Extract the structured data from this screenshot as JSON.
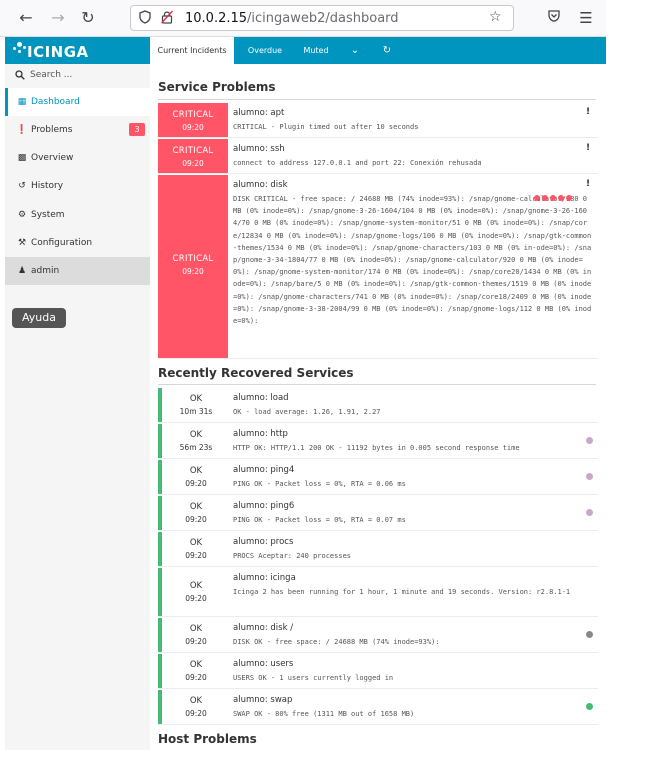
{
  "browser": {
    "url_host": "10.0.2.15",
    "url_path": "/icingaweb2/dashboard"
  },
  "sidebar": {
    "logo": "ICINGA",
    "search_placeholder": "Search ...",
    "items": [
      {
        "label": "Dashboard",
        "icon": "dashboard-icon"
      },
      {
        "label": "Problems",
        "icon": "problems-icon",
        "badge": "3"
      },
      {
        "label": "Overview",
        "icon": "binoculars-icon"
      },
      {
        "label": "History",
        "icon": "history-icon"
      },
      {
        "label": "System",
        "icon": "cogs-icon"
      },
      {
        "label": "Configuration",
        "icon": "wrench-icon"
      },
      {
        "label": "admin",
        "icon": "user-icon"
      }
    ],
    "help_button": "Ayuda"
  },
  "tabs": {
    "current": "Current Incidents",
    "overdue": "Overdue",
    "muted": "Muted"
  },
  "service_problems": {
    "title": "Service Problems",
    "rows": [
      {
        "state": "CRITICAL",
        "time": "09:20",
        "service": "alumno: apt",
        "output": "CRITICAL - Plugin timed out after 10 seconds"
      },
      {
        "state": "CRITICAL",
        "time": "09:20",
        "service": "alumno: ssh",
        "output": "connect to address 127.0.0.1 and port 22: Conexión rehusada"
      },
      {
        "state": "CRITICAL",
        "time": "09:20",
        "service": "alumno: disk",
        "output": "DISK CRITICAL - free space: / 24688 MB (74% inode=93%): /snap/gnome-calculator/180 0 MB (0% inode=0%): /snap/gnome-3-26-1604/104 0 MB (0% inode=0%): /snap/gnome-3-26-1604/70 0 MB (0% inode=0%): /snap/gnome-system-monitor/51 0 MB (0% inode=0%): /snap/core/12834 0 MB (0% inode=0%): /snap/gnome-logs/106 0 MB (0% inode=0%): /snap/gtk-common-themes/1534 0 MB (0% inode=0%): /snap/gnome-characters/103 0 MB (0% in-ode=0%): /snap/gnome-3-34-1804/77 0 MB (0% inode=0%): /snap/gnome-calculator/920 0 MB (0% inode=0%): /snap/gnome-system-monitor/174 0 MB (0% inode=0%): /snap/core20/1434 0 MB (0% inode=0%): /snap/bare/5 0 MB (0% inode=0%): /snap/gtk-common-themes/1519 0 MB (0% inode=0%): /snap/gnome-characters/741 0 MB (0% inode=0%): /snap/core18/2409 0 MB (0% inode=0%): /snap/gnome-3-38-2004/99 0 MB (0% inode=0%): /snap/gnome-logs/112 0 MB (0% inode=0%):"
      }
    ]
  },
  "recovered": {
    "title": "Recently Recovered Services",
    "rows": [
      {
        "state": "OK",
        "time": "10m 31s",
        "service": "alumno: load",
        "output": "OK - load average: 1.26, 1.91, 2.27"
      },
      {
        "state": "OK",
        "time": "56m 23s",
        "service": "alumno: http",
        "output": "HTTP OK: HTTP/1.1 200 OK - 11192 bytes in 0.005 second response time"
      },
      {
        "state": "OK",
        "time": "09:20",
        "service": "alumno: ping4",
        "output": "PING OK - Packet loss = 0%, RTA = 0.06 ms"
      },
      {
        "state": "OK",
        "time": "09:20",
        "service": "alumno: ping6",
        "output": "PING OK - Packet loss = 0%, RTA = 0.07 ms"
      },
      {
        "state": "OK",
        "time": "09:20",
        "service": "alumno: procs",
        "output": "PROCS Aceptar: 240 processes"
      },
      {
        "state": "OK",
        "time": "09:20",
        "service": "alumno: icinga",
        "output": "Icinga 2 has been running for 1 hour, 1 minute and 19 seconds. Version: r2.8.1-1"
      },
      {
        "state": "OK",
        "time": "09:20",
        "service": "alumno: disk /",
        "output": "DISK OK - free space: / 24688 MB (74% inode=93%):"
      },
      {
        "state": "OK",
        "time": "09:20",
        "service": "alumno: users",
        "output": "USERS OK - 1 users currently logged in"
      },
      {
        "state": "OK",
        "time": "09:20",
        "service": "alumno: swap",
        "output": "SWAP OK - 80% free (1311 MB out of 1658 MB)"
      }
    ]
  },
  "host_problems": {
    "title": "Host Problems"
  },
  "colors": {
    "brand": "#0095bf",
    "critical": "#ff5566",
    "ok": "#44bb77"
  }
}
